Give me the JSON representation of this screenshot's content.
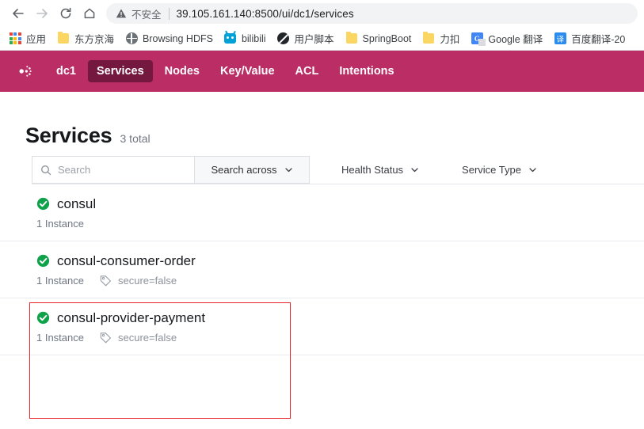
{
  "browser": {
    "back_icon": "back-arrow-icon",
    "forward_icon": "forward-arrow-icon",
    "reload_icon": "reload-icon",
    "home_icon": "home-icon",
    "security_label": "不安全",
    "security_icon": "warning-triangle-icon",
    "url": "39.105.161.140:8500/ui/dc1/services",
    "bookmarks": [
      {
        "label": "应用",
        "icon": "apps-grid-icon"
      },
      {
        "label": "东方京海",
        "icon": "folder-icon"
      },
      {
        "label": "Browsing HDFS",
        "icon": "globe-icon"
      },
      {
        "label": "bilibili",
        "icon": "bilibili-icon"
      },
      {
        "label": "用户脚本",
        "icon": "tampermonkey-icon"
      },
      {
        "label": "SpringBoot",
        "icon": "folder-icon"
      },
      {
        "label": "力扣",
        "icon": "folder-icon"
      },
      {
        "label": "Google 翻译",
        "icon": "google-translate-icon"
      },
      {
        "label": "百度翻译-20",
        "icon": "baidu-translate-icon"
      }
    ]
  },
  "consul": {
    "brand_color": "#ba2d65",
    "active_color": "#75183f",
    "logo_icon": "consul-logo-icon",
    "nav": [
      {
        "label": "dc1",
        "active": false
      },
      {
        "label": "Services",
        "active": true
      },
      {
        "label": "Nodes",
        "active": false
      },
      {
        "label": "Key/Value",
        "active": false
      },
      {
        "label": "ACL",
        "active": false
      },
      {
        "label": "Intentions",
        "active": false
      }
    ],
    "page": {
      "title": "Services",
      "total": "3 total"
    },
    "filters": {
      "search_placeholder": "Search",
      "search_value": "",
      "search_icon": "search-icon",
      "search_across_label": "Search across",
      "health_status_label": "Health Status",
      "service_type_label": "Service Type",
      "chevron_icon": "chevron-down-icon"
    },
    "services": [
      {
        "name": "consul",
        "health": "passing",
        "health_icon": "check-circle-icon",
        "instances": "1 Instance",
        "tag": "",
        "tag_icon": "",
        "highlighted": false
      },
      {
        "name": "consul-consumer-order",
        "health": "passing",
        "health_icon": "check-circle-icon",
        "instances": "1 Instance",
        "tag": "secure=false",
        "tag_icon": "tag-icon",
        "highlighted": true
      },
      {
        "name": "consul-provider-payment",
        "health": "passing",
        "health_icon": "check-circle-icon",
        "instances": "1 Instance",
        "tag": "secure=false",
        "tag_icon": "tag-icon",
        "highlighted": true
      }
    ],
    "annotation": {
      "highlight_color": "#e8242a"
    }
  }
}
